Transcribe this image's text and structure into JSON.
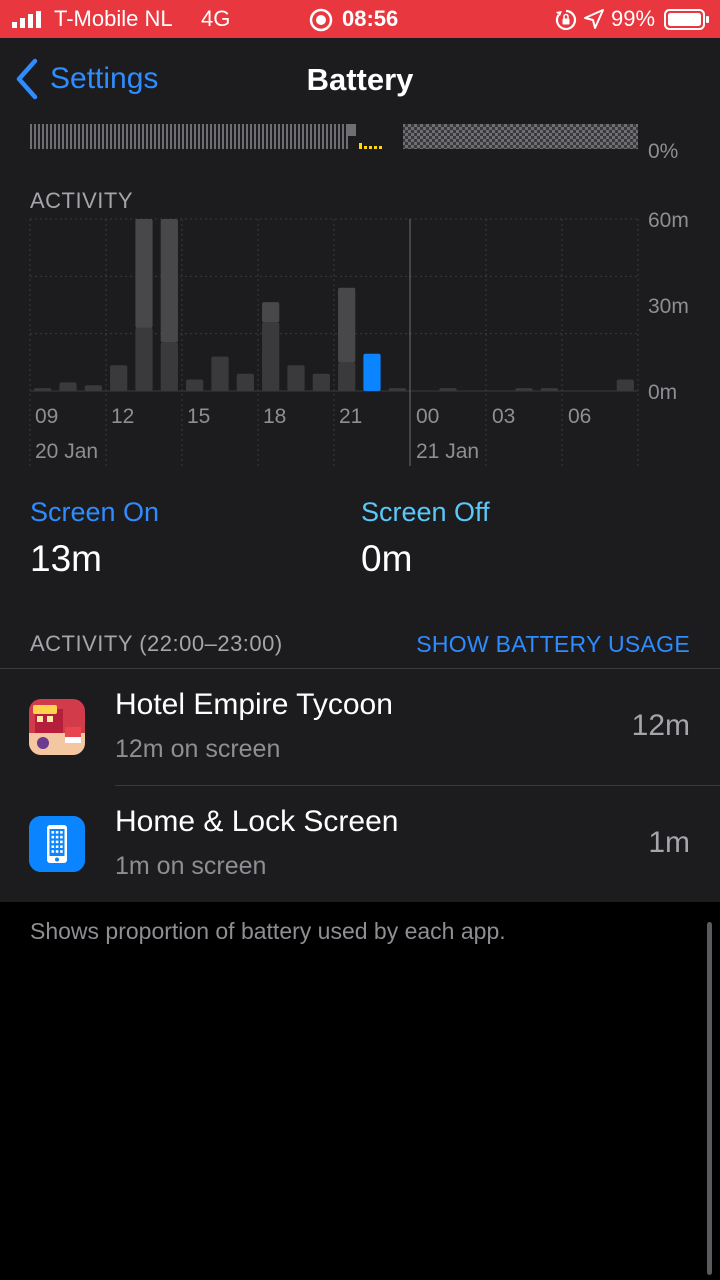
{
  "status_bar": {
    "carrier": "T-Mobile NL",
    "network": "4G",
    "time": "08:56",
    "battery_percent": "99%",
    "icons": [
      "signal-bars-icon",
      "screen-record-icon",
      "rotation-lock-icon",
      "location-arrow-icon",
      "battery-icon"
    ]
  },
  "nav": {
    "back_label": "Settings",
    "title": "Battery"
  },
  "level_chart": {
    "y_tick_bottom": "0%"
  },
  "activity": {
    "title": "ACTIVITY",
    "y_ticks": [
      "60m",
      "30m",
      "0m"
    ],
    "x_ticks": [
      "09",
      "12",
      "15",
      "18",
      "21",
      "00",
      "03",
      "06"
    ],
    "date_labels": [
      "20 Jan",
      "21 Jan"
    ]
  },
  "chart_data": {
    "type": "bar",
    "title": "ACTIVITY",
    "unit": "minutes",
    "ylim": [
      0,
      60
    ],
    "y_ticks": [
      0,
      30,
      60
    ],
    "x_tick_labels": [
      "09",
      "12",
      "15",
      "18",
      "21",
      "00",
      "03",
      "06"
    ],
    "date_labels": [
      "20 Jan",
      "21 Jan"
    ],
    "bars": [
      {
        "hour": "08",
        "screen_on": 1,
        "screen_off": 0
      },
      {
        "hour": "09",
        "screen_on": 3,
        "screen_off": 0
      },
      {
        "hour": "10",
        "screen_on": 2,
        "screen_off": 0
      },
      {
        "hour": "11",
        "screen_on": 9,
        "screen_off": 0
      },
      {
        "hour": "12",
        "screen_on": 22,
        "screen_off": 38
      },
      {
        "hour": "13",
        "screen_on": 17,
        "screen_off": 43
      },
      {
        "hour": "14",
        "screen_on": 4,
        "screen_off": 0
      },
      {
        "hour": "15",
        "screen_on": 12,
        "screen_off": 0
      },
      {
        "hour": "16",
        "screen_on": 6,
        "screen_off": 0
      },
      {
        "hour": "17",
        "screen_on": 24,
        "screen_off": 7
      },
      {
        "hour": "18",
        "screen_on": 9,
        "screen_off": 0
      },
      {
        "hour": "19",
        "screen_on": 6,
        "screen_off": 0
      },
      {
        "hour": "20",
        "screen_on": 10,
        "screen_off": 26
      },
      {
        "hour": "21",
        "screen_on": 13,
        "screen_off": 0,
        "selected": true
      },
      {
        "hour": "22",
        "screen_on": 1,
        "screen_off": 0
      },
      {
        "hour": "23",
        "screen_on": 0,
        "screen_off": 0
      },
      {
        "hour": "00",
        "screen_on": 1,
        "screen_off": 0
      },
      {
        "hour": "01",
        "screen_on": 0,
        "screen_off": 0
      },
      {
        "hour": "02",
        "screen_on": 0,
        "screen_off": 0
      },
      {
        "hour": "03",
        "screen_on": 1,
        "screen_off": 0
      },
      {
        "hour": "04",
        "screen_on": 1,
        "screen_off": 0
      },
      {
        "hour": "05",
        "screen_on": 0,
        "screen_off": 0
      },
      {
        "hour": "06",
        "screen_on": 0,
        "screen_off": 0
      },
      {
        "hour": "07",
        "screen_on": 4,
        "screen_off": 0
      }
    ]
  },
  "stats": {
    "screen_on_label": "Screen On",
    "screen_on_value": "13m",
    "screen_off_label": "Screen Off",
    "screen_off_value": "0m"
  },
  "usage": {
    "section_label": "ACTIVITY (22:00–23:00)",
    "show_usage_link": "SHOW BATTERY USAGE",
    "apps": [
      {
        "name": "Hotel Empire Tycoon",
        "sub": "12m on screen",
        "time": "12m",
        "icon": "hotel-empire-tycoon-icon"
      },
      {
        "name": "Home & Lock Screen",
        "sub": "1m on screen",
        "time": "1m",
        "icon": "home-lock-screen-icon"
      }
    ]
  },
  "footer_text": "Shows proportion of battery used by each app.",
  "colors": {
    "status_bar": "#e8373f",
    "accent": "#2f8cff",
    "screen_off_label": "#5ac8fa",
    "bar_gray": "#48484a",
    "bar_gray_dark": "#3a3a3c",
    "selected_bar": "#0a84ff"
  }
}
